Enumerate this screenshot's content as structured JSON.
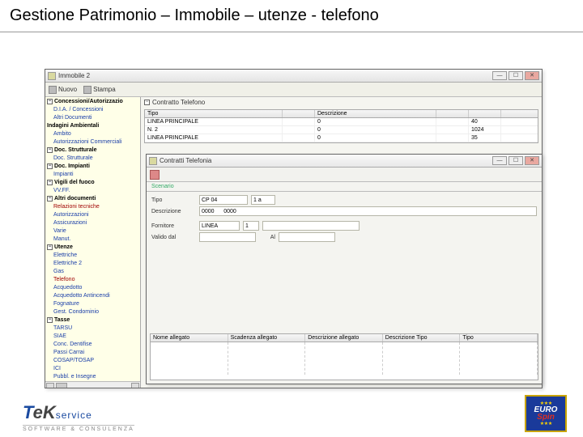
{
  "page": {
    "title": "Gestione Patrimonio – Immobile – utenze - telefono"
  },
  "main_window": {
    "title": "Immobile 2",
    "toolbar": {
      "nuovo": "Nuovo",
      "stampa": "Stampa"
    },
    "tree": {
      "items": [
        {
          "label": "Concessioni/Autorizzazio",
          "bold": true,
          "expand": "−"
        },
        {
          "label": "D.I.A. / Concessioni",
          "child": true
        },
        {
          "label": "Altri Documenti",
          "child": true
        },
        {
          "label": "Indagini Ambientali",
          "bold": true
        },
        {
          "label": "Ambito",
          "child": true
        },
        {
          "label": "Autorizzazioni Commerciali",
          "child": true
        },
        {
          "label": "Doc. Strutturale",
          "bold": true,
          "expand": "−"
        },
        {
          "label": "Doc. Strutturale",
          "child": true
        },
        {
          "label": "Doc. Impianti",
          "bold": true,
          "expand": "−"
        },
        {
          "label": "Impianti",
          "child": true
        },
        {
          "label": "Vigili del fuoco",
          "bold": true,
          "expand": "−"
        },
        {
          "label": "VV.FF.",
          "child": true
        },
        {
          "label": "Altri documenti",
          "bold": true,
          "expand": "−"
        },
        {
          "label": "Relazioni tecniche",
          "child": true,
          "red": true
        },
        {
          "label": "Autorizzazioni",
          "child": true
        },
        {
          "label": "Assicurazioni",
          "child": true
        },
        {
          "label": "Varie",
          "child": true
        },
        {
          "label": "Manut.",
          "child": true
        },
        {
          "label": "Utenze",
          "bold": true,
          "expand": "−"
        },
        {
          "label": "Elettriche",
          "child": true
        },
        {
          "label": "Elettriche 2",
          "child": true
        },
        {
          "label": "Gas",
          "child": true
        },
        {
          "label": "Telefono",
          "child": true,
          "red": true
        },
        {
          "label": "Acquedotto",
          "child": true
        },
        {
          "label": "Acquedotto Antincendi",
          "child": true
        },
        {
          "label": "Fognature",
          "child": true
        },
        {
          "label": "Gest. Condominio",
          "child": true
        },
        {
          "label": "Tasse",
          "bold": true,
          "expand": "−"
        },
        {
          "label": "TARSU",
          "child": true
        },
        {
          "label": "SIAE",
          "child": true
        },
        {
          "label": "Conc. Dentifise",
          "child": true
        },
        {
          "label": "Passi Carrai",
          "child": true
        },
        {
          "label": "COSAP/TOSAP",
          "child": true
        },
        {
          "label": "ICI",
          "child": true
        },
        {
          "label": "Pubbl. e Insegne",
          "child": true
        }
      ]
    },
    "section": {
      "label": "Contratto Telefono"
    },
    "grid": {
      "headers": [
        "Tipo",
        "",
        "Descrizione",
        "",
        ""
      ],
      "rows": [
        [
          "LINEA PRINCIPALE",
          "",
          "0",
          "",
          "40"
        ],
        [
          "N. 2",
          "",
          "0",
          "",
          "1024"
        ],
        [
          "LINEA PRINCIPALE",
          "",
          "0",
          "",
          "35"
        ]
      ]
    }
  },
  "dialog": {
    "title": "Contratti Telefonia",
    "tab": "Scenario",
    "form": {
      "tipo_label": "Tipo",
      "tipo_value": "CP 04",
      "tipo_extra": "1 a",
      "descr_label": "Descrizione",
      "descr_value": "0000      0000",
      "fornitore_label": "Fornitore",
      "fornitore_value": "LINEA",
      "fornitore_num": "1",
      "fornitore_extra": "",
      "valido_label": "Valido dal",
      "valido_al_label": "Al"
    },
    "attach_headers": [
      "Nome allegato",
      "Scadenza allegato",
      "Descrizione allegato",
      "Descrizione Tipo",
      "Tipo"
    ]
  },
  "logos": {
    "tek_service": "service",
    "tek_sub": "SOFTWARE & CONSULENZA",
    "euro": "EURO",
    "spin": "Spin"
  }
}
